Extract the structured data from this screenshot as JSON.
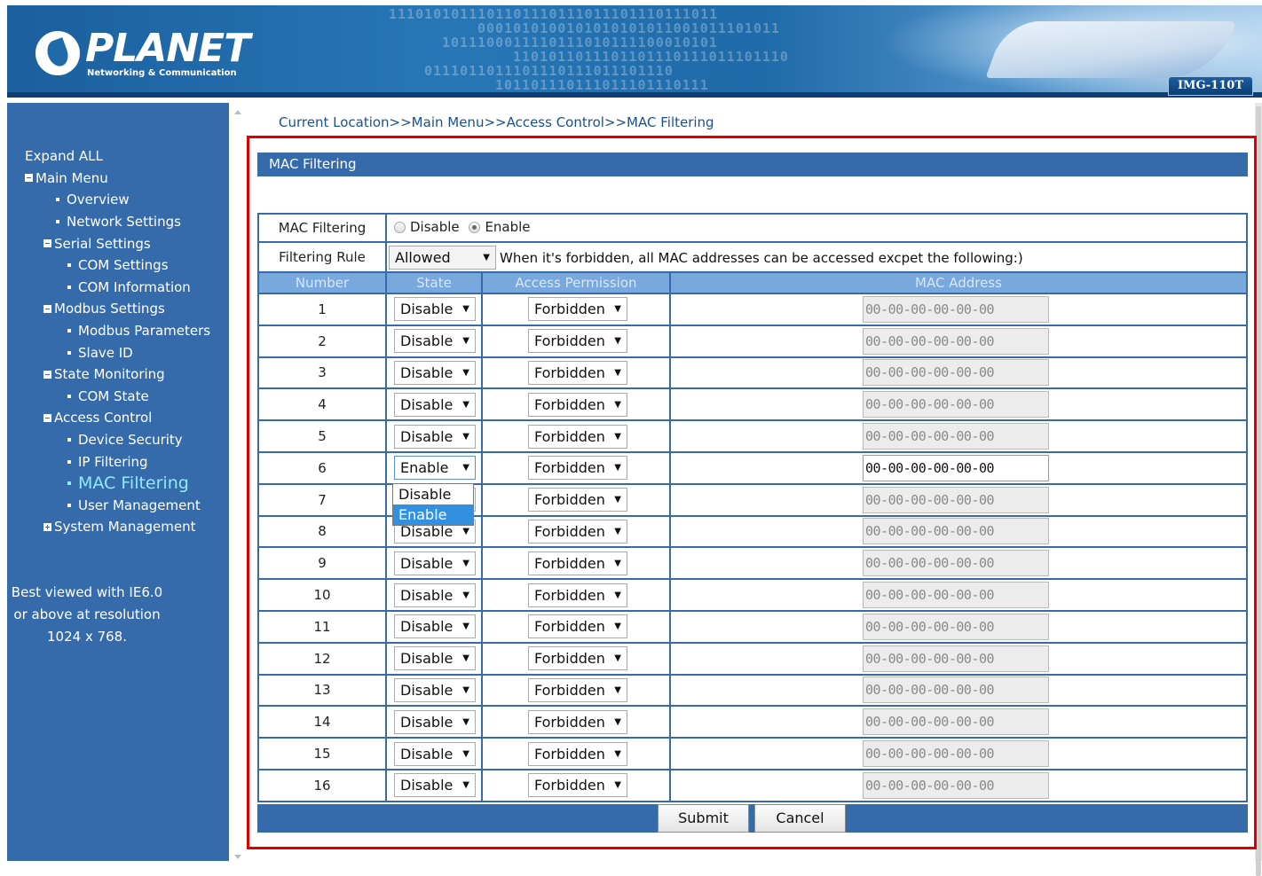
{
  "header": {
    "brand": "PLANET",
    "tagline": "Networking & Communication",
    "model": "IMG-110T",
    "binary_rows": [
      "1110101011101101110111011101110111011",
      "0001010100101010101011001011101011",
      "1011100011110111010111100010101",
      "1101011011101101110111011101110",
      "0111011011101110111011101110",
      "101101110111011101110111"
    ]
  },
  "sidebar": {
    "expand_all": "Expand ALL",
    "main_menu": "Main Menu",
    "items": {
      "overview": "Overview",
      "network_settings": "Network Settings",
      "serial_settings": "Serial Settings",
      "com_settings": "COM Settings",
      "com_information": "COM Information",
      "modbus_settings": "Modbus Settings",
      "modbus_parameters": "Modbus Parameters",
      "slave_id": "Slave ID",
      "state_monitoring": "State Monitoring",
      "com_state": "COM State",
      "access_control": "Access Control",
      "device_security": "Device Security",
      "ip_filtering": "IP Filtering",
      "mac_filtering": "MAC Filtering",
      "user_management": "User Management",
      "system_management": "System Management"
    },
    "best_viewed": [
      "Best viewed with IE6.0",
      "or above at resolution",
      "1024 x 768."
    ]
  },
  "breadcrumb": "Current Location>>Main Menu>>Access Control>>MAC Filtering",
  "panel_title": "MAC Filtering",
  "form": {
    "mac_filtering_label": "MAC Filtering",
    "radio_disable": "Disable",
    "radio_enable": "Enable",
    "radio_selected": "Enable",
    "filtering_rule_label": "Filtering Rule",
    "filtering_rule_value": "Allowed",
    "filtering_rule_note": "When it's forbidden, all MAC addresses can be accessed excpet the following:)"
  },
  "table": {
    "headers": [
      "Number",
      "State",
      "Access Permission",
      "MAC Address"
    ],
    "rows": [
      {
        "number": "1",
        "state": "Disable",
        "permission": "Forbidden",
        "mac": "00-00-00-00-00-00"
      },
      {
        "number": "2",
        "state": "Disable",
        "permission": "Forbidden",
        "mac": "00-00-00-00-00-00"
      },
      {
        "number": "3",
        "state": "Disable",
        "permission": "Forbidden",
        "mac": "00-00-00-00-00-00"
      },
      {
        "number": "4",
        "state": "Disable",
        "permission": "Forbidden",
        "mac": "00-00-00-00-00-00"
      },
      {
        "number": "5",
        "state": "Disable",
        "permission": "Forbidden",
        "mac": "00-00-00-00-00-00"
      },
      {
        "number": "6",
        "state": "Enable",
        "permission": "Forbidden",
        "mac": "00-00-00-00-00-00"
      },
      {
        "number": "7",
        "state": "Disable",
        "permission": "Forbidden",
        "mac": "00-00-00-00-00-00"
      },
      {
        "number": "8",
        "state": "Disable",
        "permission": "Forbidden",
        "mac": "00-00-00-00-00-00"
      },
      {
        "number": "9",
        "state": "Disable",
        "permission": "Forbidden",
        "mac": "00-00-00-00-00-00"
      },
      {
        "number": "10",
        "state": "Disable",
        "permission": "Forbidden",
        "mac": "00-00-00-00-00-00"
      },
      {
        "number": "11",
        "state": "Disable",
        "permission": "Forbidden",
        "mac": "00-00-00-00-00-00"
      },
      {
        "number": "12",
        "state": "Disable",
        "permission": "Forbidden",
        "mac": "00-00-00-00-00-00"
      },
      {
        "number": "13",
        "state": "Disable",
        "permission": "Forbidden",
        "mac": "00-00-00-00-00-00"
      },
      {
        "number": "14",
        "state": "Disable",
        "permission": "Forbidden",
        "mac": "00-00-00-00-00-00"
      },
      {
        "number": "15",
        "state": "Disable",
        "permission": "Forbidden",
        "mac": "00-00-00-00-00-00"
      },
      {
        "number": "16",
        "state": "Disable",
        "permission": "Forbidden",
        "mac": "00-00-00-00-00-00"
      }
    ],
    "enabled_row": "6"
  },
  "state_dropdown": {
    "options": [
      "Disable",
      "Enable"
    ],
    "highlighted": "Enable"
  },
  "buttons": {
    "submit": "Submit",
    "cancel": "Cancel"
  },
  "colors": {
    "navy": "#366bab",
    "header_row": "#79a8dd",
    "active_nav": "#8fe9ff",
    "highlight_frame": "#e00000",
    "dropdown_highlight": "#3390e0"
  }
}
